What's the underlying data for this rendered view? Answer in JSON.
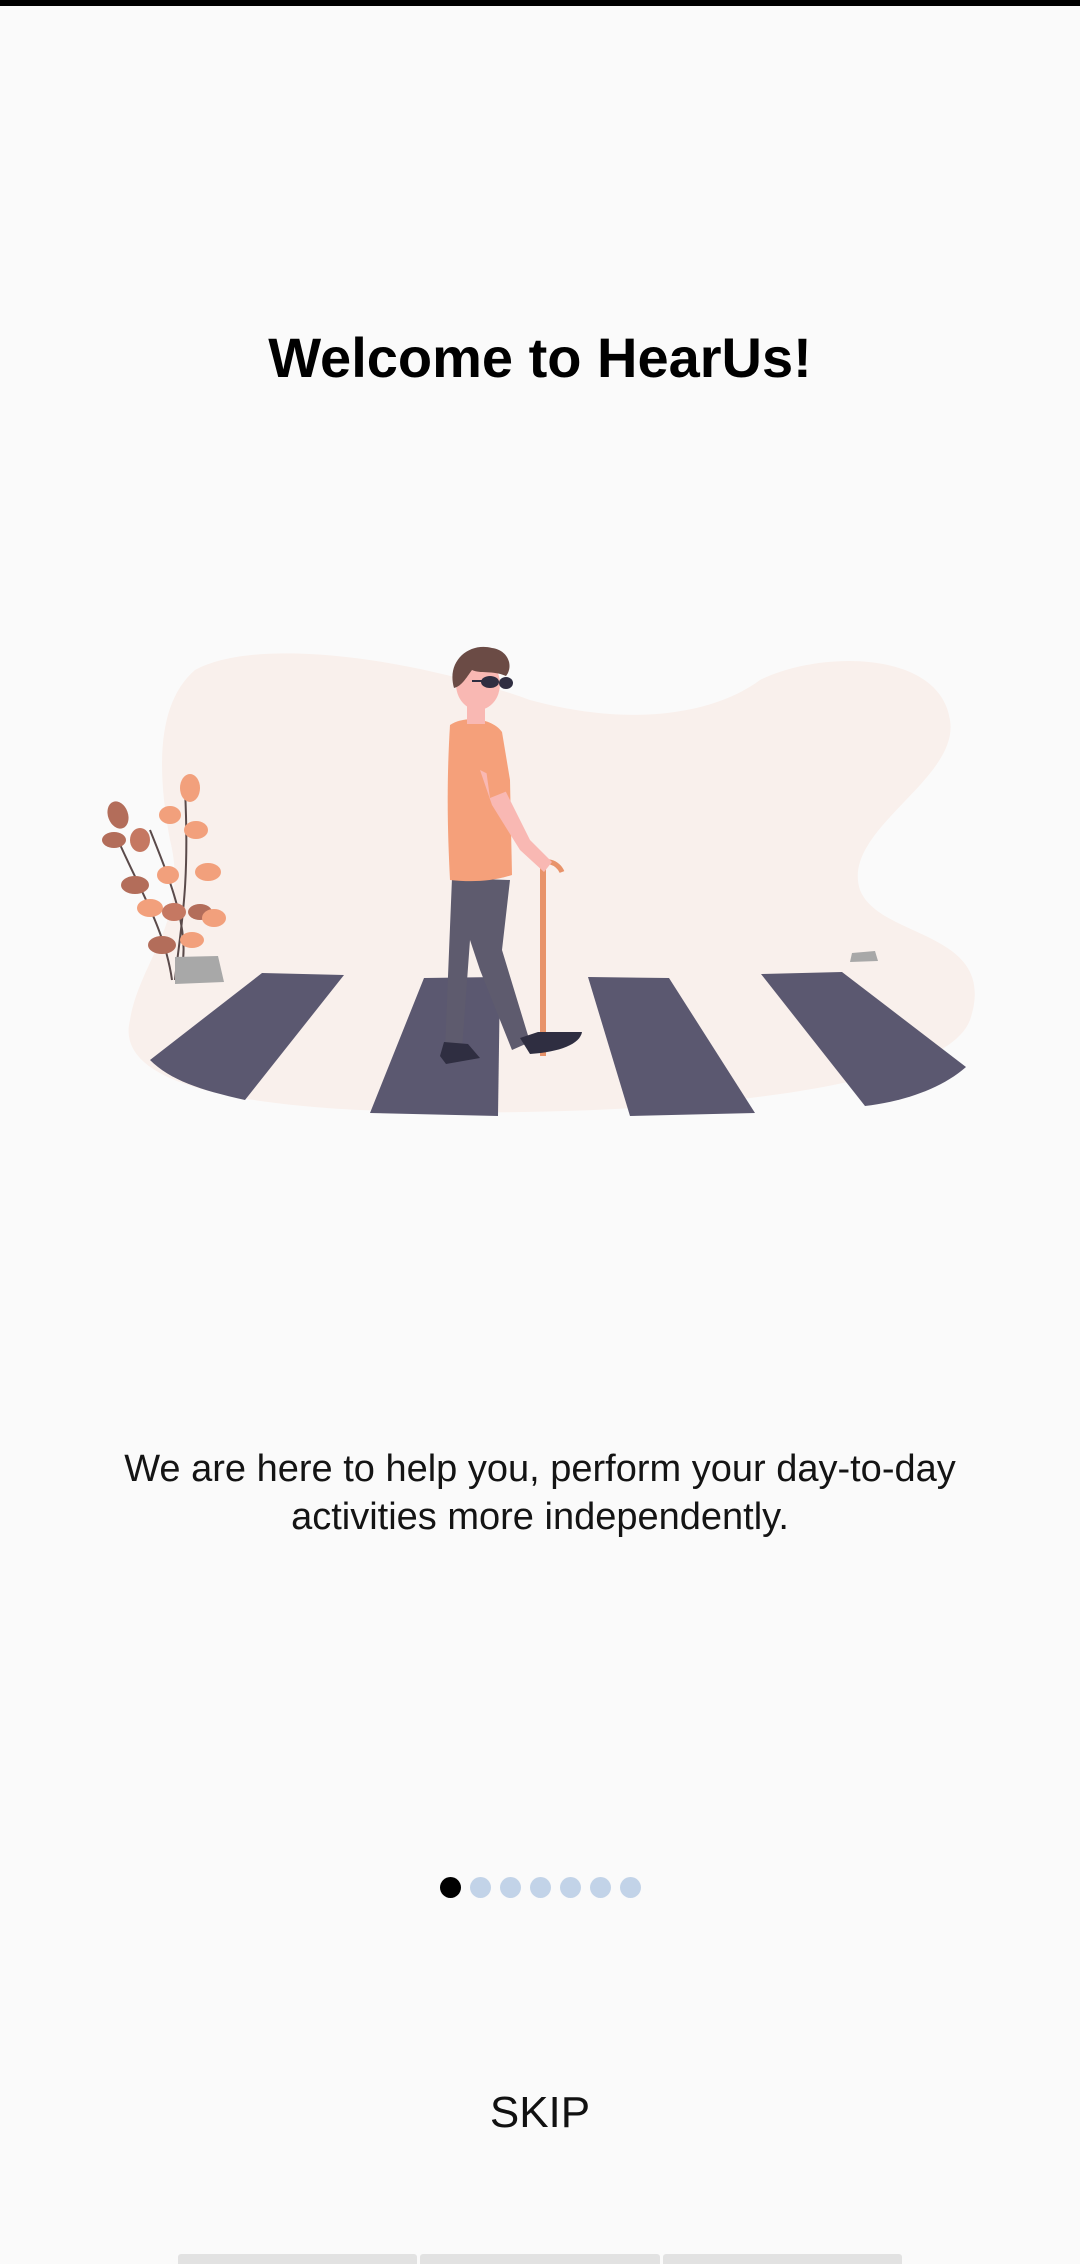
{
  "onboarding": {
    "title": "Welcome to HearUs!",
    "description": "We are here to help you, perform your day-to-day activities more independently.",
    "illustration": "person-with-white-cane-crossing-street",
    "pager": {
      "total_pages": 7,
      "current_page": 1,
      "active_color": "#000000",
      "inactive_color": "#c2d3e8"
    },
    "skip_label": "SKIP"
  },
  "colors": {
    "background": "#fafafa",
    "blob": "#f9f0ec",
    "crosswalk": "#5b5870",
    "shirt": "#f5a07a",
    "pants": "#5e5b6e",
    "cane": "#e8936a"
  }
}
